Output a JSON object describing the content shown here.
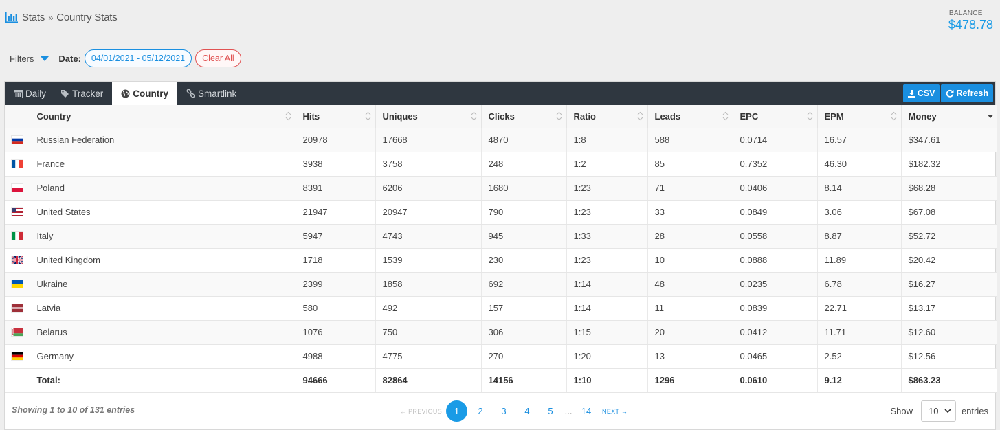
{
  "breadcrumb": {
    "section": "Stats",
    "separator": "»",
    "page": "Country Stats"
  },
  "balance": {
    "label": "BALANCE",
    "value": "$478.78"
  },
  "filters": {
    "label": "Filters",
    "date_label": "Date:",
    "date_range": "04/01/2021 - 05/12/2021",
    "clear_label": "Clear All"
  },
  "tabs": [
    {
      "label": "Daily",
      "icon": "calendar-icon"
    },
    {
      "label": "Tracker",
      "icon": "tag-icon"
    },
    {
      "label": "Country",
      "icon": "globe-icon",
      "active": true
    },
    {
      "label": "Smartlink",
      "icon": "link-icon"
    }
  ],
  "actions": {
    "csv": "CSV",
    "refresh": "Refresh"
  },
  "table": {
    "columns": [
      "Country",
      "Hits",
      "Uniques",
      "Clicks",
      "Ratio",
      "Leads",
      "EPC",
      "EPM",
      "Money"
    ],
    "rows": [
      {
        "flag": "ru",
        "country": "Russian Federation",
        "hits": "20978",
        "uniques": "17668",
        "clicks": "4870",
        "ratio": "1:8",
        "leads": "588",
        "epc": "0.0714",
        "epm": "16.57",
        "money": "$347.61"
      },
      {
        "flag": "fr",
        "country": "France",
        "hits": "3938",
        "uniques": "3758",
        "clicks": "248",
        "ratio": "1:2",
        "leads": "85",
        "epc": "0.7352",
        "epm": "46.30",
        "money": "$182.32"
      },
      {
        "flag": "pl",
        "country": "Poland",
        "hits": "8391",
        "uniques": "6206",
        "clicks": "1680",
        "ratio": "1:23",
        "leads": "71",
        "epc": "0.0406",
        "epm": "8.14",
        "money": "$68.28"
      },
      {
        "flag": "us",
        "country": "United States",
        "hits": "21947",
        "uniques": "20947",
        "clicks": "790",
        "ratio": "1:23",
        "leads": "33",
        "epc": "0.0849",
        "epm": "3.06",
        "money": "$67.08"
      },
      {
        "flag": "it",
        "country": "Italy",
        "hits": "5947",
        "uniques": "4743",
        "clicks": "945",
        "ratio": "1:33",
        "leads": "28",
        "epc": "0.0558",
        "epm": "8.87",
        "money": "$52.72"
      },
      {
        "flag": "gb",
        "country": "United Kingdom",
        "hits": "1718",
        "uniques": "1539",
        "clicks": "230",
        "ratio": "1:23",
        "leads": "10",
        "epc": "0.0888",
        "epm": "11.89",
        "money": "$20.42"
      },
      {
        "flag": "ua",
        "country": "Ukraine",
        "hits": "2399",
        "uniques": "1858",
        "clicks": "692",
        "ratio": "1:14",
        "leads": "48",
        "epc": "0.0235",
        "epm": "6.78",
        "money": "$16.27"
      },
      {
        "flag": "lv",
        "country": "Latvia",
        "hits": "580",
        "uniques": "492",
        "clicks": "157",
        "ratio": "1:14",
        "leads": "11",
        "epc": "0.0839",
        "epm": "22.71",
        "money": "$13.17"
      },
      {
        "flag": "by",
        "country": "Belarus",
        "hits": "1076",
        "uniques": "750",
        "clicks": "306",
        "ratio": "1:15",
        "leads": "20",
        "epc": "0.0412",
        "epm": "11.71",
        "money": "$12.60"
      },
      {
        "flag": "de",
        "country": "Germany",
        "hits": "4988",
        "uniques": "4775",
        "clicks": "270",
        "ratio": "1:20",
        "leads": "13",
        "epc": "0.0465",
        "epm": "2.52",
        "money": "$12.56"
      }
    ],
    "total": {
      "label": "Total:",
      "hits": "94666",
      "uniques": "82864",
      "clicks": "14156",
      "ratio": "1:10",
      "leads": "1296",
      "epc": "0.0610",
      "epm": "9.12",
      "money": "$863.23"
    }
  },
  "pagination": {
    "info": "Showing 1 to 10 of 131 entries",
    "previous": "← PREVIOUS",
    "next": "NEXT →",
    "pages": [
      "1",
      "2",
      "3",
      "4",
      "5"
    ],
    "ellipsis": "...",
    "last_page": "14",
    "current": "1"
  },
  "page_size": {
    "show_label": "Show",
    "value": "10",
    "entries_label": "entries"
  },
  "colors": {
    "accent": "#1a8fe0",
    "tabbar": "#2f3740",
    "clear": "#e05252"
  }
}
